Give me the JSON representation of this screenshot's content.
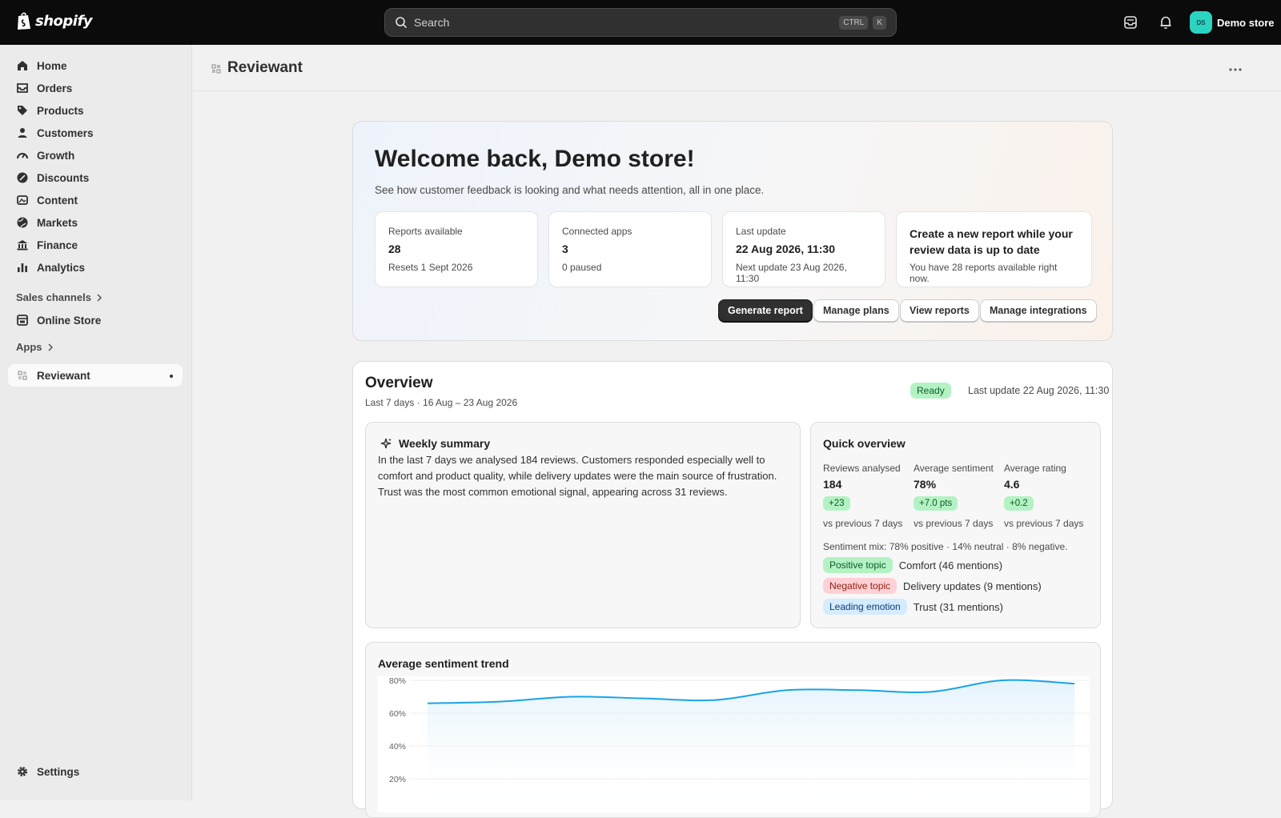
{
  "topbar": {
    "brand": "shopify",
    "search_placeholder": "Search",
    "kbd_ctrl": "CTRL",
    "kbd_k": "K",
    "store_initials": "DS",
    "store_name": "Demo store"
  },
  "sidebar": {
    "items": [
      {
        "label": "Home",
        "icon": "home-icon"
      },
      {
        "label": "Orders",
        "icon": "orders-icon"
      },
      {
        "label": "Products",
        "icon": "tag-icon"
      },
      {
        "label": "Customers",
        "icon": "person-icon"
      },
      {
        "label": "Growth",
        "icon": "gauge-icon"
      },
      {
        "label": "Discounts",
        "icon": "discount-icon"
      },
      {
        "label": "Content",
        "icon": "content-icon"
      },
      {
        "label": "Markets",
        "icon": "globe-icon"
      },
      {
        "label": "Finance",
        "icon": "bank-icon"
      },
      {
        "label": "Analytics",
        "icon": "bar-chart-icon"
      }
    ],
    "sales_channels_label": "Sales channels",
    "online_store_label": "Online Store",
    "apps_label": "Apps",
    "app_label": "Reviewant",
    "settings_label": "Settings"
  },
  "page": {
    "title": "Reviewant"
  },
  "welcome": {
    "heading": "Welcome back, Demo store!",
    "subtitle": "See how customer feedback is looking and what needs attention, all in one place.",
    "stats": [
      {
        "label": "Reports available",
        "value": "28",
        "note": "Resets 1 Sept 2026"
      },
      {
        "label": "Connected apps",
        "value": "3",
        "note": "0 paused"
      },
      {
        "label": "Last update",
        "value": "22 Aug 2026, 11:30",
        "note": "Next update 23 Aug 2026, 11:30"
      }
    ],
    "cta_title": "Create a new report while your review data is up to date",
    "cta_note": "You have 28 reports available right now.",
    "buttons": {
      "generate": "Generate report",
      "plans": "Manage plans",
      "reports": "View reports",
      "integrations": "Manage integrations"
    }
  },
  "overview": {
    "title": "Overview",
    "range": "Last 7 days · 16 Aug – 23 Aug 2026",
    "status": "Ready",
    "last_update": "Last update 22 Aug 2026, 11:30",
    "weekly": {
      "title": "Weekly summary",
      "text": "In the last 7 days we analysed 184 reviews. Customers responded especially well to comfort and product quality, while delivery updates were the main source of frustration. Trust was the most common emotional signal, appearing across 31 reviews."
    },
    "quick": {
      "title": "Quick overview",
      "metrics": [
        {
          "label": "Reviews analysed",
          "value": "184",
          "delta": "+23",
          "vs": "vs previous 7 days"
        },
        {
          "label": "Average sentiment",
          "value": "78%",
          "delta": "+7.0 pts",
          "vs": "vs previous 7 days"
        },
        {
          "label": "Average rating",
          "value": "4.6",
          "delta": "+0.2",
          "vs": "vs previous 7 days"
        }
      ],
      "mix": "Sentiment mix: 78% positive · 14% neutral · 8% negative.",
      "topics": [
        {
          "tag": "Positive topic",
          "text": "Comfort (46 mentions)"
        },
        {
          "tag": "Negative topic",
          "text": "Delivery updates (9 mentions)"
        },
        {
          "tag": "Leading emotion",
          "text": "Trust (31 mentions)"
        }
      ]
    }
  },
  "chart_data": {
    "type": "line",
    "title": "Average sentiment trend",
    "yticks": [
      "80%",
      "60%",
      "40%",
      "20%"
    ],
    "ylim": [
      0,
      80
    ],
    "x": [
      0,
      1,
      2,
      3,
      4,
      5,
      6,
      7,
      8,
      9
    ],
    "values": [
      66,
      67,
      70,
      69,
      68,
      74,
      74,
      73,
      80,
      78
    ],
    "color": "#1aa3e8"
  }
}
